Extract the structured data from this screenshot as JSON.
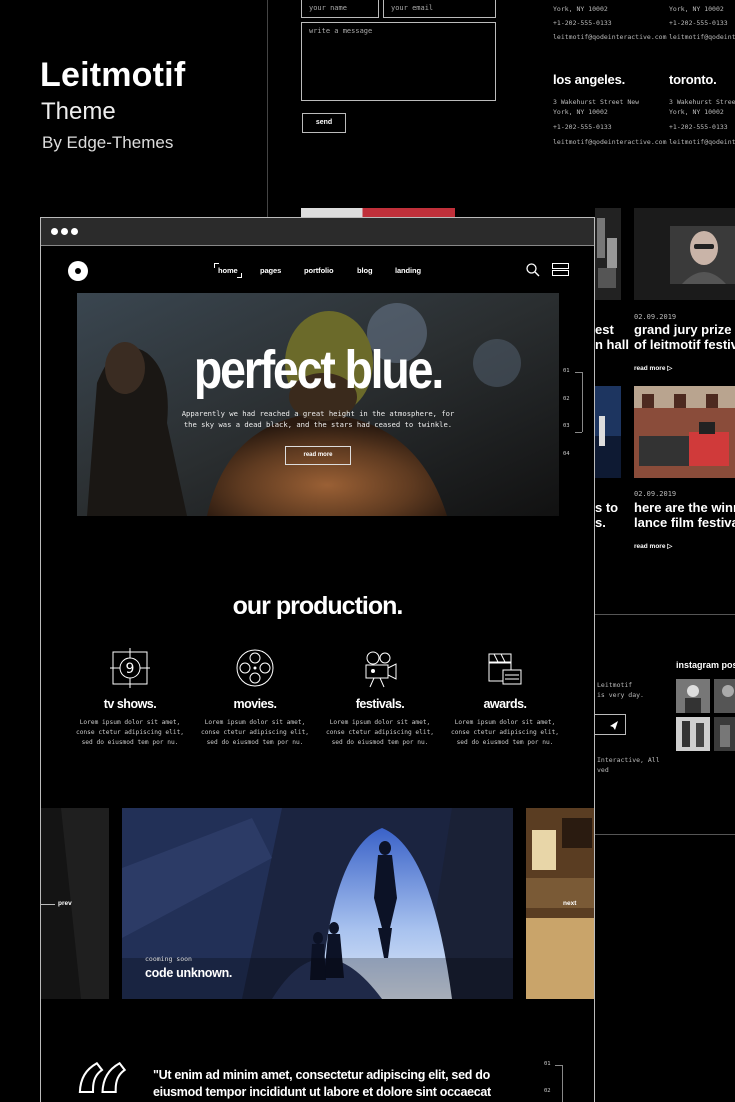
{
  "promo": {
    "title": "Leitmotif",
    "subtitle": "Theme",
    "by": "By Edge-Themes"
  },
  "contact_preview": {
    "name_placeholder": "your name",
    "email_placeholder": "your email",
    "message_placeholder": "write a message",
    "send_label": "send",
    "offices_top": [
      {
        "lines": [
          "York, NY 10002",
          "+1-202-555-0133",
          "leitmotif@qodeinteractive.com"
        ]
      },
      {
        "lines": [
          "York, NY 10002",
          "+1-202-555-0133",
          "leitmotif@qodeinter"
        ]
      }
    ],
    "offices": [
      {
        "city": "los angeles.",
        "address": "3 Wakehurst Street New",
        "address2": "York, NY 10002",
        "phone": "+1-202-555-0133",
        "email": "leitmotif@qodeinteractive.com"
      },
      {
        "city": "toronto.",
        "address": "3 Wakehurst Street",
        "address2": "York, NY 10002",
        "phone": "+1-202-555-0133",
        "email": "leitmotif@qodeinter"
      }
    ]
  },
  "blog_preview": {
    "posts": [
      {
        "title_line1": "est",
        "title_line2": "n hall"
      },
      {
        "date": "02.09.2019",
        "title_line1": "grand jury prize –",
        "title_line2": "of leitmotif festiva",
        "more": "read more ▷"
      },
      {
        "title_line1": "s to",
        "title_line2": "s."
      },
      {
        "date": "02.09.2019",
        "title_line1": "here are the winne",
        "title_line2": "lance film festival",
        "more": "read more ▷"
      }
    ],
    "instagram_title": "instagram post",
    "footer_lines": [
      "Leitmotif",
      "is very day.",
      "Interactive, All",
      "ved"
    ]
  },
  "site": {
    "nav": [
      "home",
      "pages",
      "portfolio",
      "blog",
      "landing"
    ],
    "hero": {
      "title": "perfect blue.",
      "desc_line1": "Apparently we had reached a great height in the atmosphere, for",
      "desc_line2": "the sky was a dead black, and the stars had ceased to twinkle.",
      "button": "read more"
    },
    "slider_numbers": [
      "01",
      "02",
      "03",
      "04"
    ],
    "production": {
      "title": "our production.",
      "items": [
        {
          "name": "tv shows.",
          "icon": "tv-countdown-icon",
          "d1": "Lorem ipsum dolor sit amet,",
          "d2": "conse ctetur adipiscing elit,",
          "d3": "sed do eiusmod tem por nu."
        },
        {
          "name": "movies.",
          "icon": "film-reel-icon",
          "d1": "Lorem ipsum dolor sit amet,",
          "d2": "conse ctetur adipiscing elit,",
          "d3": "sed do eiusmod tem por nu."
        },
        {
          "name": "festivals.",
          "icon": "movie-camera-icon",
          "d1": "Lorem ipsum dolor sit amet,",
          "d2": "conse ctetur adipiscing elit,",
          "d3": "sed do eiusmod tem por nu."
        },
        {
          "name": "awards.",
          "icon": "clapperboard-icon",
          "d1": "Lorem ipsum dolor sit amet,",
          "d2": "conse ctetur adipiscing elit,",
          "d3": "sed do eiusmod tem por nu."
        }
      ]
    },
    "carousel": {
      "prev": "prev",
      "next": "next",
      "slide_tag": "cooming soon",
      "slide_title": "code unknown."
    },
    "quote": {
      "text": "\"Ut enim ad minim amet, consectetur adipiscing elit, sed do eiusmod tempor incididunt ut labore et dolore sint occaecat cupidata.\"",
      "numbers": [
        "01",
        "02"
      ]
    }
  }
}
